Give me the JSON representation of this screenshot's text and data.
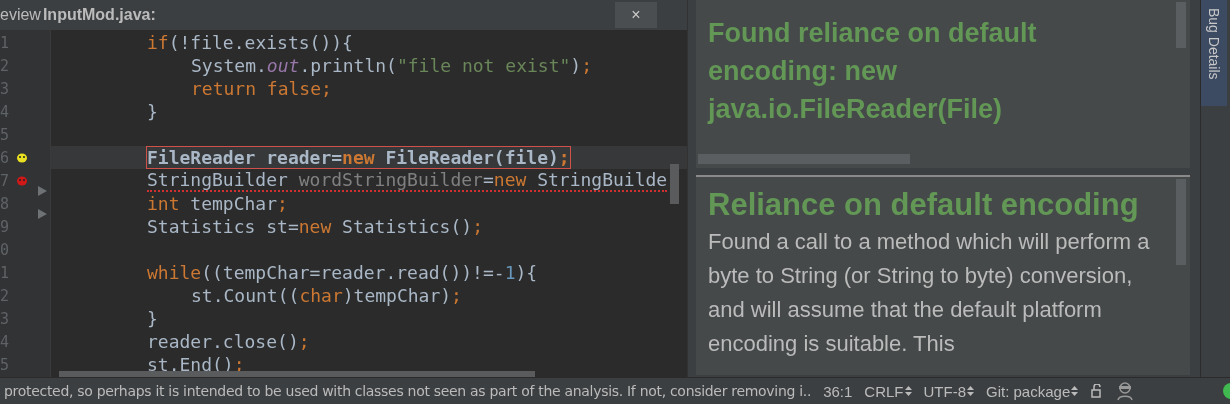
{
  "editor": {
    "title_prefix": "eview",
    "file_name": "InputMod.java:",
    "close": "×",
    "lines": [
      {
        "kind": "code",
        "number": "1",
        "highlighted": false,
        "warning": false,
        "fold": false,
        "tokens": [
          {
            "kind": "keyword",
            "text": "if"
          },
          {
            "kind": "plain",
            "text": "(!file.exists()){"
          }
        ],
        "children": [
          {
            "kind": "code",
            "number": "2",
            "highlighted": false,
            "warning": false,
            "fold": false,
            "tokens": [
              {
                "kind": "plain",
                "text": "System."
              },
              {
                "kind": "static",
                "text": "out"
              },
              {
                "kind": "plain",
                "text": ".println("
              },
              {
                "kind": "string",
                "text": "\"file not exist\""
              },
              {
                "kind": "plain",
                "text": ")"
              },
              {
                "kind": "keyword",
                "text": ";"
              }
            ]
          },
          {
            "kind": "code",
            "number": "3",
            "highlighted": false,
            "warning": false,
            "fold": false,
            "tokens": [
              {
                "kind": "keyword",
                "text": "return false;"
              }
            ]
          }
        ]
      },
      {
        "kind": "code",
        "number": "4",
        "highlighted": false,
        "warning": false,
        "fold": false,
        "tokens": [
          {
            "kind": "plain",
            "text": "}"
          }
        ]
      },
      {
        "kind": "blank",
        "number": "5"
      },
      {
        "kind": "code",
        "number": "6",
        "highlighted": true,
        "warning": false,
        "fold": false,
        "bug": {
          "color": "#e8e020"
        },
        "tokens": [
          {
            "kind": "plain",
            "text": "FileReader reader="
          },
          {
            "kind": "keyword",
            "text": "new"
          },
          {
            "kind": "plain",
            "text": " FileReader(file)"
          },
          {
            "kind": "keyword",
            "text": ";"
          }
        ]
      },
      {
        "kind": "code",
        "number": "7",
        "highlighted": false,
        "warning": true,
        "fold": true,
        "bug": {
          "color": "#d01818"
        },
        "tokens": [
          {
            "kind": "plain",
            "text": "StringBuilder "
          },
          {
            "kind": "unused",
            "text": "wordStringBuilder"
          },
          {
            "kind": "plain",
            "text": "="
          },
          {
            "kind": "keyword",
            "text": "new"
          },
          {
            "kind": "plain",
            "text": " StringBuilde"
          }
        ]
      },
      {
        "kind": "code",
        "number": "8",
        "highlighted": false,
        "warning": false,
        "fold": true,
        "tokens": [
          {
            "kind": "keyword",
            "text": "int"
          },
          {
            "kind": "plain",
            "text": " tempChar"
          },
          {
            "kind": "keyword",
            "text": ";"
          }
        ]
      },
      {
        "kind": "code",
        "number": "9",
        "highlighted": false,
        "warning": false,
        "fold": false,
        "tokens": [
          {
            "kind": "plain",
            "text": "Statistics st="
          },
          {
            "kind": "keyword",
            "text": "new"
          },
          {
            "kind": "plain",
            "text": " Statistics()"
          },
          {
            "kind": "keyword",
            "text": ";"
          }
        ]
      },
      {
        "kind": "blank",
        "number": "0"
      },
      {
        "kind": "code",
        "number": "1",
        "highlighted": false,
        "warning": false,
        "fold": false,
        "tokens": [
          {
            "kind": "keyword",
            "text": "while"
          },
          {
            "kind": "plain",
            "text": "((tempChar=reader.read())!=-"
          },
          {
            "kind": "number",
            "text": "1"
          },
          {
            "kind": "plain",
            "text": "){"
          }
        ],
        "children": [
          {
            "kind": "code",
            "number": "2",
            "highlighted": false,
            "warning": false,
            "fold": false,
            "tokens": [
              {
                "kind": "plain",
                "text": "st.Count(("
              },
              {
                "kind": "keyword",
                "text": "char"
              },
              {
                "kind": "plain",
                "text": ")tempChar)"
              },
              {
                "kind": "keyword",
                "text": ";"
              }
            ]
          }
        ]
      },
      {
        "kind": "code",
        "number": "3",
        "highlighted": false,
        "warning": false,
        "fold": false,
        "tokens": [
          {
            "kind": "plain",
            "text": "}"
          }
        ]
      },
      {
        "kind": "code",
        "number": "4",
        "highlighted": false,
        "warning": false,
        "fold": false,
        "tokens": [
          {
            "kind": "plain",
            "text": "reader.close()"
          },
          {
            "kind": "keyword",
            "text": ";"
          }
        ]
      },
      {
        "kind": "code",
        "number": "5",
        "highlighted": false,
        "warning": false,
        "fold": false,
        "tokens": [
          {
            "kind": "plain",
            "text": "st.End()"
          },
          {
            "kind": "keyword",
            "text": ";"
          }
        ]
      }
    ]
  },
  "bug_panel": {
    "summary": "Found reliance on default encoding: new java.io.FileReader(File)",
    "heading": "Reliance on default encoding",
    "description": "Found a call to a method which will perform a byte to String (or String to byte) conversion, and will assume that the default platform encoding is suitable. This"
  },
  "side_tabs": [
    {
      "label": "Bug Details",
      "selected": true
    }
  ],
  "status_bar": {
    "message": "protected, so perhaps it is intended to be used with classes not seen as part of the analysis. If not, consider removing i..",
    "position": "36:1",
    "widgets": [
      {
        "label": "CRLF"
      },
      {
        "label": "UTF-8"
      },
      {
        "label": "Git: package"
      }
    ]
  }
}
